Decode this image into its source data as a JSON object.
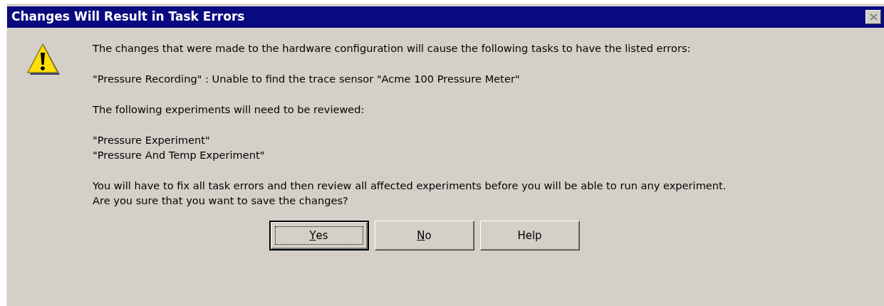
{
  "window": {
    "title": "Changes Will Result in Task Errors",
    "close_disabled": true
  },
  "message": [
    {
      "lines": [
        "The changes that were made to the hardware configuration will cause the following tasks to have the listed errors:"
      ]
    },
    {
      "lines": [
        "\"Pressure Recording\" : Unable to find the trace sensor \"Acme 100 Pressure Meter\""
      ]
    },
    {
      "lines": [
        "The following experiments will need to be reviewed:"
      ]
    },
    {
      "lines": [
        "\"Pressure Experiment\"",
        "\"Pressure And Temp Experiment\""
      ]
    },
    {
      "lines": [
        "You will have to fix all task errors and then review all affected experiments before you will be able to run any experiment.",
        "Are you sure that you want to save the changes?"
      ]
    }
  ],
  "buttons": [
    {
      "label": "Yes",
      "default": true,
      "mnemonic": true
    },
    {
      "label": "No",
      "default": false,
      "mnemonic": true
    },
    {
      "label": "Help",
      "default": false,
      "mnemonic": false
    }
  ]
}
